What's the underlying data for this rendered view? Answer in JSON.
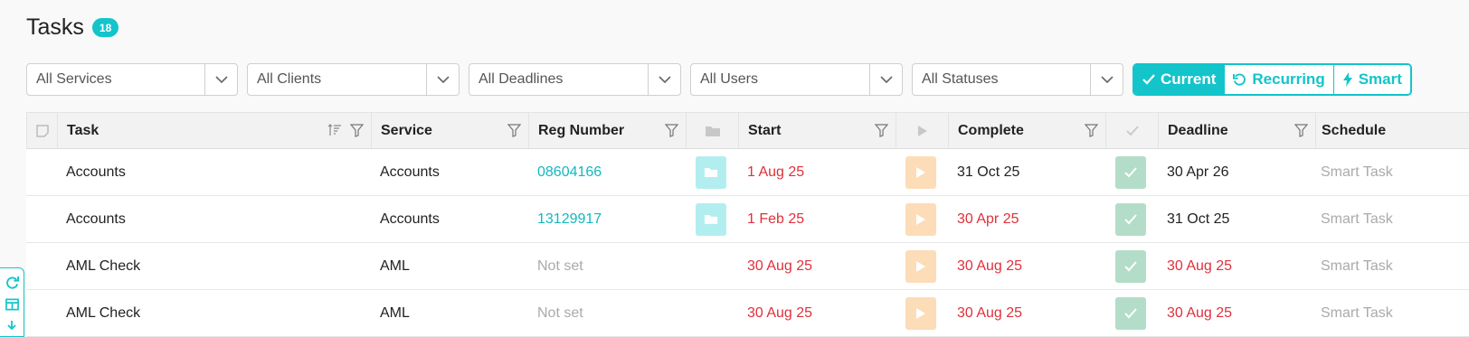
{
  "header": {
    "title": "Tasks",
    "count": "18"
  },
  "filters": [
    {
      "value": "All Services"
    },
    {
      "value": "All Clients"
    },
    {
      "value": "All Deadlines"
    },
    {
      "value": "All Users"
    },
    {
      "value": "All Statuses"
    }
  ],
  "view_toggle": {
    "current": "Current",
    "recurring": "Recurring",
    "smart": "Smart",
    "selected": "Current"
  },
  "columns": {
    "task": "Task",
    "service": "Service",
    "reg_number": "Reg Number",
    "start": "Start",
    "complete": "Complete",
    "deadline": "Deadline",
    "schedule": "Schedule"
  },
  "rows": [
    {
      "task": "Accounts",
      "service": "Accounts",
      "reg_number": "08604166",
      "start": "1 Aug 25",
      "complete": "31 Oct 25",
      "deadline": "30 Apr 26",
      "schedule": "Smart Task"
    },
    {
      "task": "Accounts",
      "service": "Accounts",
      "reg_number": "13129917",
      "start": "1 Feb 25",
      "complete": "30 Apr 25",
      "deadline": "31 Oct 25",
      "schedule": "Smart Task"
    },
    {
      "task": "AML Check",
      "service": "AML",
      "reg_number": "Not set",
      "start": "30 Aug 25",
      "complete": "30 Aug 25",
      "deadline": "30 Aug 25",
      "schedule": "Smart Task"
    },
    {
      "task": "AML Check",
      "service": "AML",
      "reg_number": "Not set",
      "start": "30 Aug 25",
      "complete": "30 Aug 25",
      "deadline": "30 Aug 25",
      "schedule": "Smart Task"
    }
  ],
  "colors": {
    "accent": "#13c4cb",
    "overdue": "#e0303b",
    "muted": "#aaaaaa"
  }
}
